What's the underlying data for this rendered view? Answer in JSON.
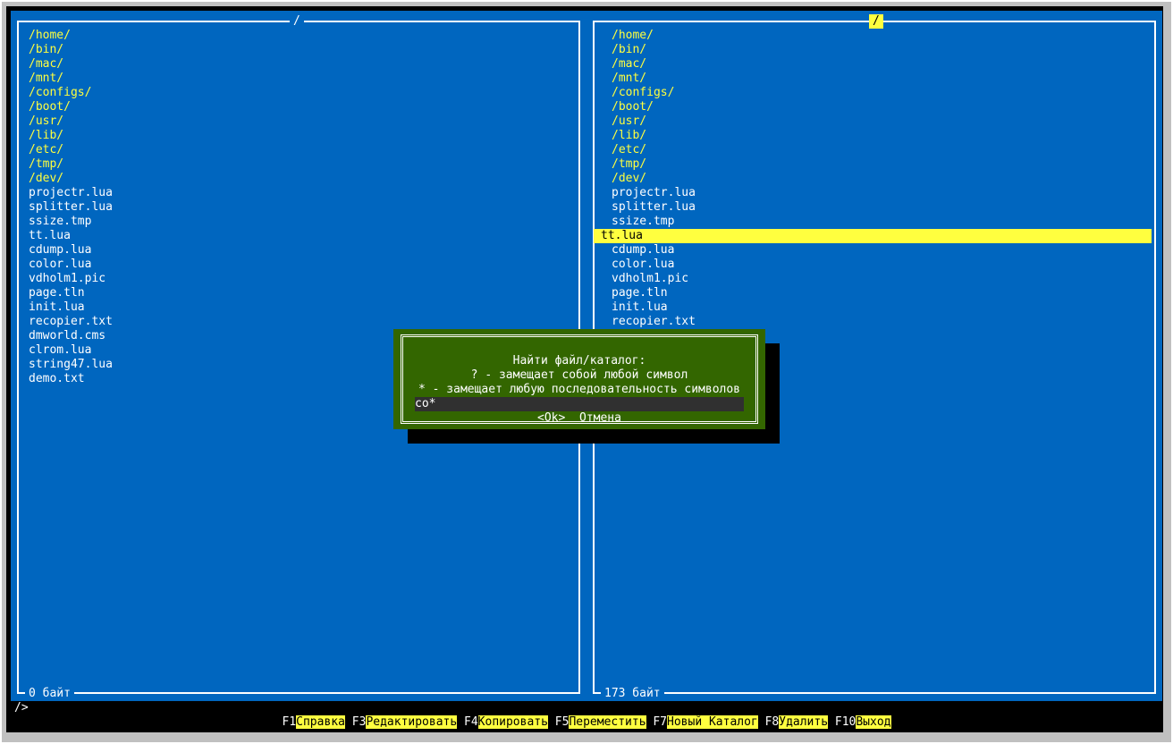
{
  "left_panel": {
    "title": "/",
    "items": [
      {
        "name": "/home/",
        "type": "dir"
      },
      {
        "name": "/bin/",
        "type": "dir"
      },
      {
        "name": "/mac/",
        "type": "dir"
      },
      {
        "name": "/mnt/",
        "type": "dir"
      },
      {
        "name": "/configs/",
        "type": "dir"
      },
      {
        "name": "/boot/",
        "type": "dir"
      },
      {
        "name": "/usr/",
        "type": "dir"
      },
      {
        "name": "/lib/",
        "type": "dir"
      },
      {
        "name": "/etc/",
        "type": "dir"
      },
      {
        "name": "/tmp/",
        "type": "dir"
      },
      {
        "name": "/dev/",
        "type": "dir"
      },
      {
        "name": "projectr.lua",
        "type": "file"
      },
      {
        "name": "splitter.lua",
        "type": "file"
      },
      {
        "name": "ssize.tmp",
        "type": "file"
      },
      {
        "name": "tt.lua",
        "type": "file"
      },
      {
        "name": "cdump.lua",
        "type": "file"
      },
      {
        "name": "color.lua",
        "type": "file"
      },
      {
        "name": "vdholm1.pic",
        "type": "file"
      },
      {
        "name": "page.tln",
        "type": "file"
      },
      {
        "name": "init.lua",
        "type": "file"
      },
      {
        "name": "recopier.txt",
        "type": "file"
      },
      {
        "name": "dmworld.cms",
        "type": "file"
      },
      {
        "name": "clrom.lua",
        "type": "file"
      },
      {
        "name": "string47.lua",
        "type": "file"
      },
      {
        "name": "demo.txt",
        "type": "file"
      }
    ],
    "footer": "0 байт"
  },
  "right_panel": {
    "title": "/",
    "items": [
      {
        "name": "/home/",
        "type": "dir"
      },
      {
        "name": "/bin/",
        "type": "dir"
      },
      {
        "name": "/mac/",
        "type": "dir"
      },
      {
        "name": "/mnt/",
        "type": "dir"
      },
      {
        "name": "/configs/",
        "type": "dir"
      },
      {
        "name": "/boot/",
        "type": "dir"
      },
      {
        "name": "/usr/",
        "type": "dir"
      },
      {
        "name": "/lib/",
        "type": "dir"
      },
      {
        "name": "/etc/",
        "type": "dir"
      },
      {
        "name": "/tmp/",
        "type": "dir"
      },
      {
        "name": "/dev/",
        "type": "dir"
      },
      {
        "name": "projectr.lua",
        "type": "file"
      },
      {
        "name": "splitter.lua",
        "type": "file"
      },
      {
        "name": "ssize.tmp",
        "type": "file"
      },
      {
        "name": "tt.lua",
        "type": "file",
        "selected": true
      },
      {
        "name": "cdump.lua",
        "type": "file"
      },
      {
        "name": "color.lua",
        "type": "file"
      },
      {
        "name": "vdholm1.pic",
        "type": "file"
      },
      {
        "name": "page.tln",
        "type": "file"
      },
      {
        "name": "init.lua",
        "type": "file"
      },
      {
        "name": "recopier.txt",
        "type": "file"
      }
    ],
    "footer": "173 байт"
  },
  "command_line": "/>",
  "function_keys": [
    {
      "key": "F1",
      "label": "Справка"
    },
    {
      "key": "F3",
      "label": "Редактировать"
    },
    {
      "key": "F4",
      "label": "Копировать"
    },
    {
      "key": "F5",
      "label": "Переместить"
    },
    {
      "key": "F7",
      "label": "Новый Каталог"
    },
    {
      "key": "F8",
      "label": "Удалить"
    },
    {
      "key": "F10",
      "label": "Выход"
    }
  ],
  "dialog": {
    "title": "Найти файл/каталог:",
    "hint1": "? - замещает собой любой символ",
    "hint2": "* - замещает любую последовательность символов",
    "input_value": "co*",
    "ok_label": "<Ok>",
    "cancel_label": "Отмена"
  },
  "colors": {
    "panel_bg": "#0066bf",
    "dir_text": "#ffff3f",
    "file_text": "#ffffff",
    "highlight": "#ffff3f",
    "dialog_bg": "#336600"
  }
}
